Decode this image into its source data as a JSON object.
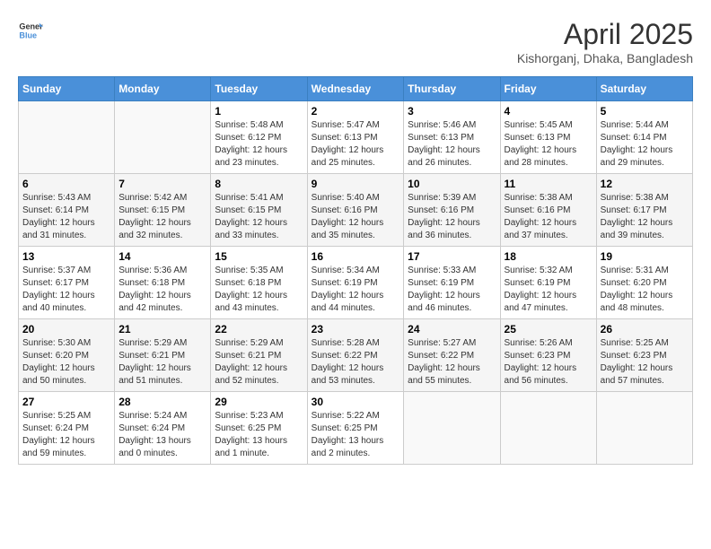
{
  "logo": {
    "general": "General",
    "blue": "Blue"
  },
  "title": "April 2025",
  "location": "Kishorganj, Dhaka, Bangladesh",
  "weekdays": [
    "Sunday",
    "Monday",
    "Tuesday",
    "Wednesday",
    "Thursday",
    "Friday",
    "Saturday"
  ],
  "weeks": [
    [
      {
        "day": "",
        "info": ""
      },
      {
        "day": "",
        "info": ""
      },
      {
        "day": "1",
        "info": "Sunrise: 5:48 AM\nSunset: 6:12 PM\nDaylight: 12 hours and 23 minutes."
      },
      {
        "day": "2",
        "info": "Sunrise: 5:47 AM\nSunset: 6:13 PM\nDaylight: 12 hours and 25 minutes."
      },
      {
        "day": "3",
        "info": "Sunrise: 5:46 AM\nSunset: 6:13 PM\nDaylight: 12 hours and 26 minutes."
      },
      {
        "day": "4",
        "info": "Sunrise: 5:45 AM\nSunset: 6:13 PM\nDaylight: 12 hours and 28 minutes."
      },
      {
        "day": "5",
        "info": "Sunrise: 5:44 AM\nSunset: 6:14 PM\nDaylight: 12 hours and 29 minutes."
      }
    ],
    [
      {
        "day": "6",
        "info": "Sunrise: 5:43 AM\nSunset: 6:14 PM\nDaylight: 12 hours and 31 minutes."
      },
      {
        "day": "7",
        "info": "Sunrise: 5:42 AM\nSunset: 6:15 PM\nDaylight: 12 hours and 32 minutes."
      },
      {
        "day": "8",
        "info": "Sunrise: 5:41 AM\nSunset: 6:15 PM\nDaylight: 12 hours and 33 minutes."
      },
      {
        "day": "9",
        "info": "Sunrise: 5:40 AM\nSunset: 6:16 PM\nDaylight: 12 hours and 35 minutes."
      },
      {
        "day": "10",
        "info": "Sunrise: 5:39 AM\nSunset: 6:16 PM\nDaylight: 12 hours and 36 minutes."
      },
      {
        "day": "11",
        "info": "Sunrise: 5:38 AM\nSunset: 6:16 PM\nDaylight: 12 hours and 37 minutes."
      },
      {
        "day": "12",
        "info": "Sunrise: 5:38 AM\nSunset: 6:17 PM\nDaylight: 12 hours and 39 minutes."
      }
    ],
    [
      {
        "day": "13",
        "info": "Sunrise: 5:37 AM\nSunset: 6:17 PM\nDaylight: 12 hours and 40 minutes."
      },
      {
        "day": "14",
        "info": "Sunrise: 5:36 AM\nSunset: 6:18 PM\nDaylight: 12 hours and 42 minutes."
      },
      {
        "day": "15",
        "info": "Sunrise: 5:35 AM\nSunset: 6:18 PM\nDaylight: 12 hours and 43 minutes."
      },
      {
        "day": "16",
        "info": "Sunrise: 5:34 AM\nSunset: 6:19 PM\nDaylight: 12 hours and 44 minutes."
      },
      {
        "day": "17",
        "info": "Sunrise: 5:33 AM\nSunset: 6:19 PM\nDaylight: 12 hours and 46 minutes."
      },
      {
        "day": "18",
        "info": "Sunrise: 5:32 AM\nSunset: 6:19 PM\nDaylight: 12 hours and 47 minutes."
      },
      {
        "day": "19",
        "info": "Sunrise: 5:31 AM\nSunset: 6:20 PM\nDaylight: 12 hours and 48 minutes."
      }
    ],
    [
      {
        "day": "20",
        "info": "Sunrise: 5:30 AM\nSunset: 6:20 PM\nDaylight: 12 hours and 50 minutes."
      },
      {
        "day": "21",
        "info": "Sunrise: 5:29 AM\nSunset: 6:21 PM\nDaylight: 12 hours and 51 minutes."
      },
      {
        "day": "22",
        "info": "Sunrise: 5:29 AM\nSunset: 6:21 PM\nDaylight: 12 hours and 52 minutes."
      },
      {
        "day": "23",
        "info": "Sunrise: 5:28 AM\nSunset: 6:22 PM\nDaylight: 12 hours and 53 minutes."
      },
      {
        "day": "24",
        "info": "Sunrise: 5:27 AM\nSunset: 6:22 PM\nDaylight: 12 hours and 55 minutes."
      },
      {
        "day": "25",
        "info": "Sunrise: 5:26 AM\nSunset: 6:23 PM\nDaylight: 12 hours and 56 minutes."
      },
      {
        "day": "26",
        "info": "Sunrise: 5:25 AM\nSunset: 6:23 PM\nDaylight: 12 hours and 57 minutes."
      }
    ],
    [
      {
        "day": "27",
        "info": "Sunrise: 5:25 AM\nSunset: 6:24 PM\nDaylight: 12 hours and 59 minutes."
      },
      {
        "day": "28",
        "info": "Sunrise: 5:24 AM\nSunset: 6:24 PM\nDaylight: 13 hours and 0 minutes."
      },
      {
        "day": "29",
        "info": "Sunrise: 5:23 AM\nSunset: 6:25 PM\nDaylight: 13 hours and 1 minute."
      },
      {
        "day": "30",
        "info": "Sunrise: 5:22 AM\nSunset: 6:25 PM\nDaylight: 13 hours and 2 minutes."
      },
      {
        "day": "",
        "info": ""
      },
      {
        "day": "",
        "info": ""
      },
      {
        "day": "",
        "info": ""
      }
    ]
  ]
}
